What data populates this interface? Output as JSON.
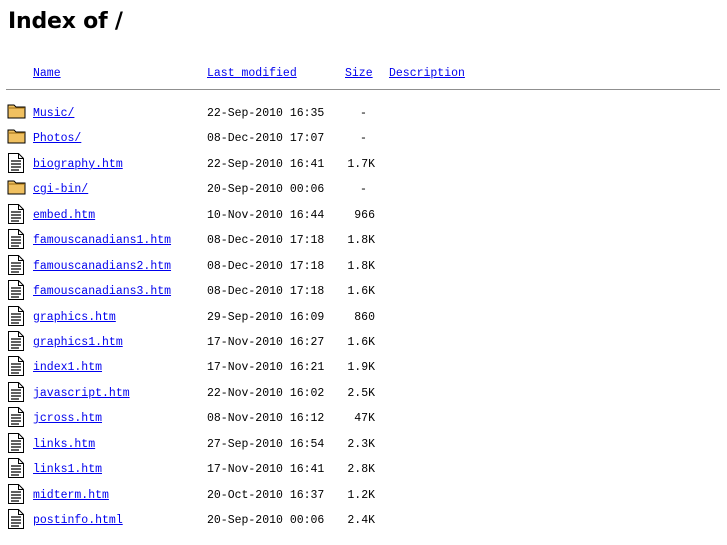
{
  "page": {
    "title": "Index of /"
  },
  "columns": {
    "name": "Name",
    "modified": "Last modified",
    "size": "Size",
    "description": "Description"
  },
  "entries": [
    {
      "name": "Music/",
      "modified": "22-Sep-2010 16:35",
      "size": "-",
      "icon": "folder-icon"
    },
    {
      "name": "Photos/",
      "modified": "08-Dec-2010 17:07",
      "size": "-",
      "icon": "folder-icon"
    },
    {
      "name": "biography.htm",
      "modified": "22-Sep-2010 16:41",
      "size": "1.7K",
      "icon": "text-file-icon"
    },
    {
      "name": "cgi-bin/",
      "modified": "20-Sep-2010 00:06",
      "size": "-",
      "icon": "folder-icon"
    },
    {
      "name": "embed.htm",
      "modified": "10-Nov-2010 16:44",
      "size": "966",
      "icon": "text-file-icon"
    },
    {
      "name": "famouscanadians1.htm",
      "modified": "08-Dec-2010 17:18",
      "size": "1.8K",
      "icon": "text-file-icon"
    },
    {
      "name": "famouscanadians2.htm",
      "modified": "08-Dec-2010 17:18",
      "size": "1.8K",
      "icon": "text-file-icon"
    },
    {
      "name": "famouscanadians3.htm",
      "modified": "08-Dec-2010 17:18",
      "size": "1.6K",
      "icon": "text-file-icon"
    },
    {
      "name": "graphics.htm",
      "modified": "29-Sep-2010 16:09",
      "size": "860",
      "icon": "text-file-icon"
    },
    {
      "name": "graphics1.htm",
      "modified": "17-Nov-2010 16:27",
      "size": "1.6K",
      "icon": "text-file-icon"
    },
    {
      "name": "index1.htm",
      "modified": "17-Nov-2010 16:21",
      "size": "1.9K",
      "icon": "text-file-icon"
    },
    {
      "name": "javascript.htm",
      "modified": "22-Nov-2010 16:02",
      "size": "2.5K",
      "icon": "text-file-icon"
    },
    {
      "name": "jcross.htm",
      "modified": "08-Nov-2010 16:12",
      "size": "47K",
      "icon": "text-file-icon"
    },
    {
      "name": "links.htm",
      "modified": "27-Sep-2010 16:54",
      "size": "2.3K",
      "icon": "text-file-icon"
    },
    {
      "name": "links1.htm",
      "modified": "17-Nov-2010 16:41",
      "size": "2.8K",
      "icon": "text-file-icon"
    },
    {
      "name": "midterm.htm",
      "modified": "20-Oct-2010 16:37",
      "size": "1.2K",
      "icon": "text-file-icon"
    },
    {
      "name": "postinfo.html",
      "modified": "20-Sep-2010 00:06",
      "size": "2.4K",
      "icon": "text-file-icon"
    }
  ],
  "colors": {
    "link": "#0000ee",
    "folder": "#e8b04a",
    "rule": "#8f8f8f"
  }
}
